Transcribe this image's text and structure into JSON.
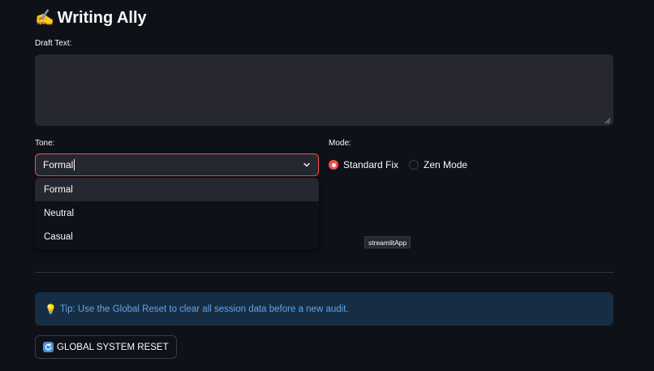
{
  "header": {
    "icon": "writing-hand-icon",
    "emoji": "✍️",
    "title": "Writing Ally"
  },
  "draft": {
    "label": "Draft Text:",
    "value": ""
  },
  "tone": {
    "label": "Tone:",
    "selected": "Formal",
    "options": [
      "Formal",
      "Neutral",
      "Casual"
    ]
  },
  "mode": {
    "label": "Mode:",
    "options": [
      "Standard Fix",
      "Zen Mode"
    ],
    "selected": "Standard Fix"
  },
  "tooltip": {
    "text": "streamlitApp"
  },
  "tip": {
    "icon": "light-bulb-icon",
    "emoji": "💡",
    "text": "Tip: Use the Global Reset to clear all session data before a new audit."
  },
  "reset_button": {
    "icon": "refresh-icon",
    "glyph": "🔄",
    "label": "GLOBAL SYSTEM RESET"
  },
  "colors": {
    "background": "#0e1117",
    "input_bg": "#262730",
    "accent": "#ff4b4b",
    "tip_bg": "#172d43",
    "tip_text": "#60a5e8"
  }
}
